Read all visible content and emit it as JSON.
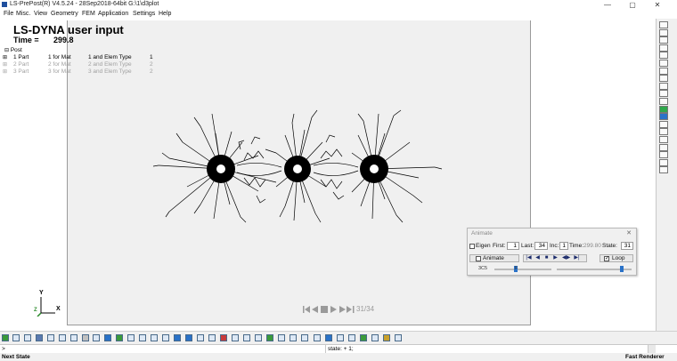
{
  "window": {
    "title": "LS-PrePost(R) V4.5.24 - 28Sep2018-64bit G:\\1\\d3plot",
    "controls": [
      "—",
      "▢",
      "✕"
    ]
  },
  "menu": [
    "File",
    "Misc.",
    "View",
    "Geometry",
    "FEM",
    "Application",
    "Settings",
    "Help"
  ],
  "header": {
    "title": "LS-DYNA user input",
    "time_label": "Time =",
    "time_value": "299.8"
  },
  "tree": {
    "root": "Post",
    "rows": [
      {
        "part": "1 Part",
        "mat": "1 for Mat",
        "elem": "1 and Elem Type",
        "n": "1",
        "active": true
      },
      {
        "part": "2 Part",
        "mat": "2 for Mat",
        "elem": "2 and Elem Type",
        "n": "2",
        "active": false
      },
      {
        "part": "3 Part",
        "mat": "3 for Mat",
        "elem": "3 and Elem Type",
        "n": "2",
        "active": false
      }
    ]
  },
  "playback": {
    "counter": "31/34"
  },
  "animate_dialog": {
    "title": "Animate",
    "eigen_label": "Eigen",
    "eigen_checked": false,
    "first_label": "First:",
    "first_value": "1",
    "last_label": "Last:",
    "last_value": "34",
    "inc_label": "Inc:",
    "inc_value": "1",
    "time_label": "Time:",
    "time_value": "299.80",
    "state_label": "State:",
    "state_value": "31",
    "animate_label": "Animate",
    "animate_checked": false,
    "loop_label": "Loop",
    "loop_checked": true,
    "slider_label": "3C5",
    "slider2_label": "F",
    "speed_level": 0.38,
    "frame_level": 0.87
  },
  "triad": {
    "y_label": "Y",
    "x_label": "X",
    "z_label": "Z"
  },
  "command": {
    "prompt": ">",
    "echo": "state: + 1;"
  },
  "status": {
    "left": "Next State",
    "right": "Fast Renderer"
  },
  "colors": {
    "accent": "#1f4f9e",
    "viewport_bg": "#f0f0f0",
    "mesh": "#000000"
  }
}
